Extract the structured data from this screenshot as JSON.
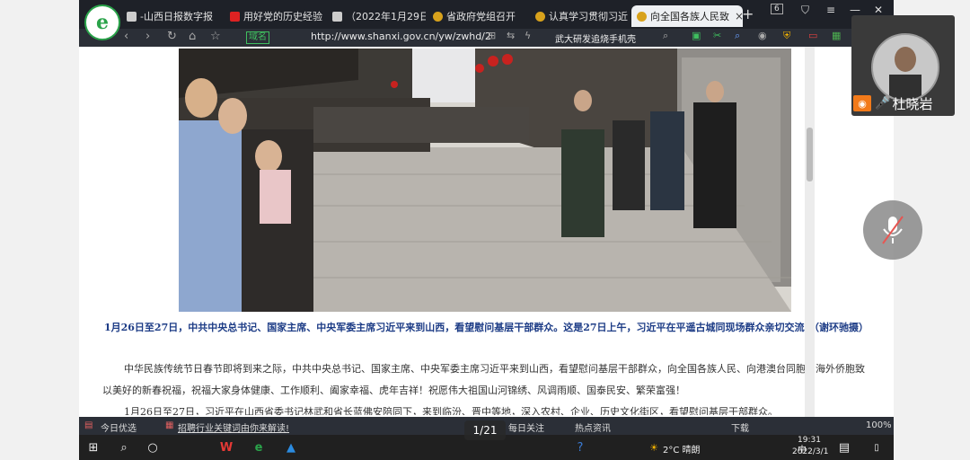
{
  "browser": {
    "tabs": [
      {
        "label": "-山西日报数字报",
        "active": false
      },
      {
        "label": "用好党的历史经验",
        "active": false
      },
      {
        "label": "（2022年1月29日",
        "active": false
      },
      {
        "label": "省政府党组召开",
        "active": false
      },
      {
        "label": "认真学习贯彻习近",
        "active": false
      },
      {
        "label": "向全国各族人民致",
        "active": true
      }
    ],
    "tab_count": "6",
    "url": "http://www.shanxi.gov.cn/yw/zwhd/2",
    "safe_label": "域名",
    "search_text": "武大研发追烧手机壳"
  },
  "article": {
    "caption": "1月26日至27日，中共中央总书记、国家主席、中央军委主席习近平来到山西，看望慰问基层干部群众。这是27日上午，习近平在平遥古城同现场群众亲切交流。（谢环驰摄）",
    "paragraph1": "中华民族传统节日春节即将到来之际，中共中央总书记、国家主席、中央军委主席习近平来到山西，看望慰问基层干部群众，向全国各族人民、向港澳台同胞和海外侨胞致以美好的新春祝福，祝福大家身体健康、工作顺利、阖家幸福、虎年吉祥！祝愿伟大祖国山河锦绣、风调雨顺、国泰民安、繁荣富强！",
    "paragraph2": "1月26日至27日，习近平在山西省委书记林武和省长蓝佛安陪同下，来到临汾、晋中等地，深入农村、企业、历史文化街区，看望慰问基层干部群众。"
  },
  "statusbar": {
    "left": "今日优选",
    "ad": "招聘行业关键词由你来解读!",
    "news1": "每日关注",
    "news2": "热点资讯",
    "download": "下载",
    "zoom": "100%"
  },
  "pager": {
    "text": "1/21"
  },
  "taskbar": {
    "weather": "2°C  晴朗",
    "time": "19:31",
    "date": "2022/3/1",
    "lang": "中"
  },
  "meeting": {
    "participant_name": "杜晓岩"
  }
}
